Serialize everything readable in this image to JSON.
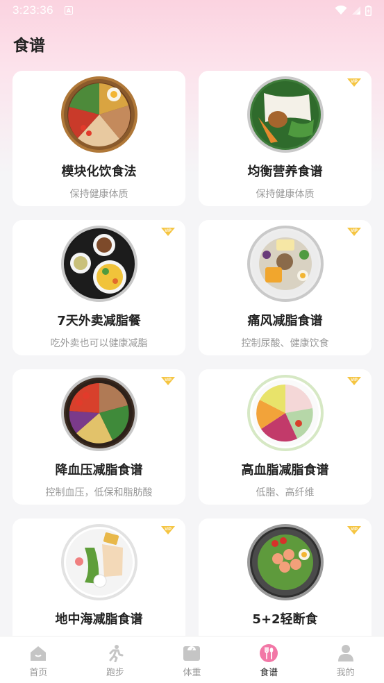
{
  "status_bar": {
    "time": "3:23:36",
    "notification_letter": "A"
  },
  "page": {
    "title": "食谱"
  },
  "recipes": [
    {
      "title": "模块化饮食法",
      "subtitle": "保持健康体质",
      "vip": false
    },
    {
      "title": "均衡营养食谱",
      "subtitle": "保持健康体质",
      "vip": true,
      "vip_label": "VIP"
    },
    {
      "title": "7天外卖减脂餐",
      "subtitle": "吃外卖也可以健康减脂",
      "vip": true,
      "vip_label": "VIP"
    },
    {
      "title": "痛风减脂食谱",
      "subtitle": "控制尿酸、健康饮食",
      "vip": true,
      "vip_label": "VIP"
    },
    {
      "title": "降血压减脂食谱",
      "subtitle": "控制血压，低保和脂肪酸",
      "vip": true,
      "vip_label": "VIP"
    },
    {
      "title": "高血脂减脂食谱",
      "subtitle": "低脂、高纤维",
      "vip": true,
      "vip_label": "VIP"
    },
    {
      "title": "地中海减脂食谱",
      "subtitle": "",
      "vip": true,
      "vip_label": "VIP"
    },
    {
      "title": "5+2轻断食",
      "subtitle": "",
      "vip": true,
      "vip_label": "VIP"
    }
  ],
  "bottom_nav": [
    {
      "label": "首页",
      "icon": "home-icon"
    },
    {
      "label": "跑步",
      "icon": "runner-icon"
    },
    {
      "label": "体重",
      "icon": "scale-icon"
    },
    {
      "label": "食谱",
      "icon": "fork-spoon-icon",
      "active": true
    },
    {
      "label": "我的",
      "icon": "person-icon"
    }
  ],
  "colors": {
    "accent": "#f277a6",
    "vip": "#f5c542",
    "nav_inactive": "#c5c5c5"
  }
}
